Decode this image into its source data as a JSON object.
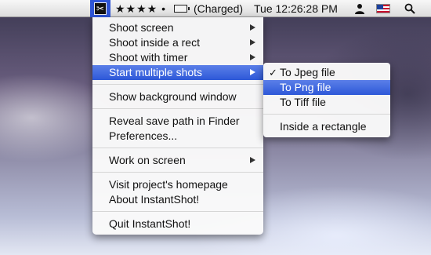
{
  "menubar": {
    "app_icon": "scissors-icon",
    "rating": "★★★★ •",
    "battery_icon": "battery-icon",
    "battery_status": "(Charged)",
    "clock": "Tue 12:26:28 PM",
    "user_icon": "user-icon",
    "input_flag_icon": "us-flag-icon",
    "spotlight_icon": "spotlight-search-icon"
  },
  "main_menu": {
    "shoot_screen": "Shoot screen",
    "shoot_inside_rect": "Shoot inside a rect",
    "shoot_with_timer": "Shoot with timer",
    "start_multiple_shots": "Start multiple shots",
    "show_background_window": "Show background window",
    "reveal_save_path": "Reveal save path in Finder",
    "preferences": "Preferences...",
    "work_on_screen": "Work on screen",
    "visit_homepage": "Visit project's homepage",
    "about": "About InstantShot!",
    "quit": "Quit InstantShot!"
  },
  "sub_menu": {
    "check_mark": "✓",
    "to_jpeg": "To Jpeg file",
    "to_png": "To Png file",
    "to_tiff": "To Tiff file",
    "inside_rectangle": "Inside a rectangle"
  },
  "colors": {
    "highlight": "#2f55d6",
    "menubar": "#e6e6e6"
  }
}
